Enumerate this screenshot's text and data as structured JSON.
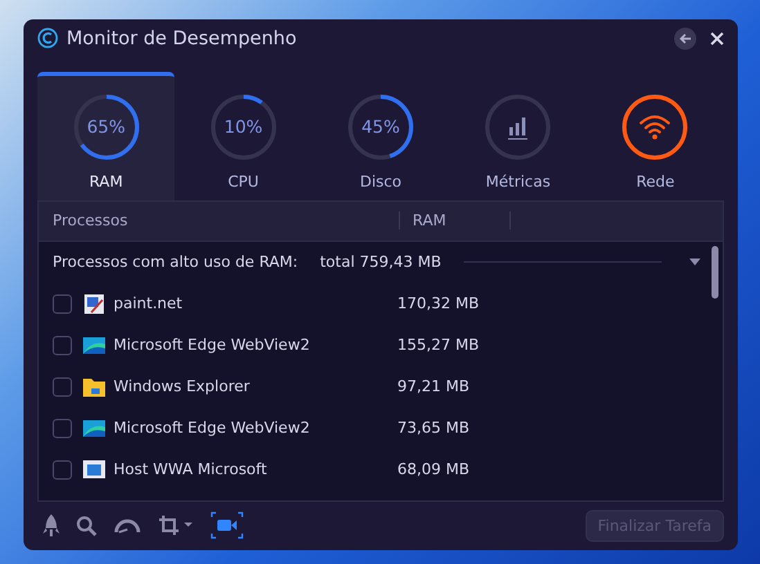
{
  "window": {
    "title": "Monitor de Desempenho"
  },
  "tabs": [
    {
      "label": "RAM",
      "kind": "gauge",
      "value": "65%",
      "level": 0.65,
      "selected": true
    },
    {
      "label": "CPU",
      "kind": "gauge",
      "value": "10%",
      "level": 0.1,
      "selected": false
    },
    {
      "label": "Disco",
      "kind": "gauge",
      "value": "45%",
      "level": 0.45,
      "selected": false
    },
    {
      "label": "Métricas",
      "kind": "metrics",
      "selected": false
    },
    {
      "label": "Rede",
      "kind": "network",
      "selected": false
    }
  ],
  "table": {
    "columns": [
      "Processos",
      "RAM"
    ],
    "group": {
      "label": "Processos com alto uso de RAM:",
      "total": "total 759,43 MB",
      "expanded": true
    },
    "rows": [
      {
        "name": "paint.net",
        "kind": "paint",
        "ram": "170,32 MB",
        "checked": false
      },
      {
        "name": "Microsoft Edge WebView2",
        "kind": "edge",
        "ram": "155,27 MB",
        "checked": false
      },
      {
        "name": "Windows Explorer",
        "kind": "folder",
        "ram": "97,21 MB",
        "checked": false
      },
      {
        "name": "Microsoft Edge WebView2",
        "kind": "edge",
        "ram": "73,65 MB",
        "checked": false
      },
      {
        "name": "Host WWA Microsoft",
        "kind": "app",
        "ram": "68,09 MB",
        "checked": false
      }
    ]
  },
  "toolbar": [
    {
      "kind": "rocket",
      "selected": false
    },
    {
      "kind": "search",
      "selected": false
    },
    {
      "kind": "gauge",
      "selected": false
    },
    {
      "kind": "crop",
      "selected": false
    },
    {
      "kind": "camera",
      "selected": true
    }
  ],
  "end_task_button": {
    "label": "Finalizar Tarefa",
    "disabled": true
  }
}
